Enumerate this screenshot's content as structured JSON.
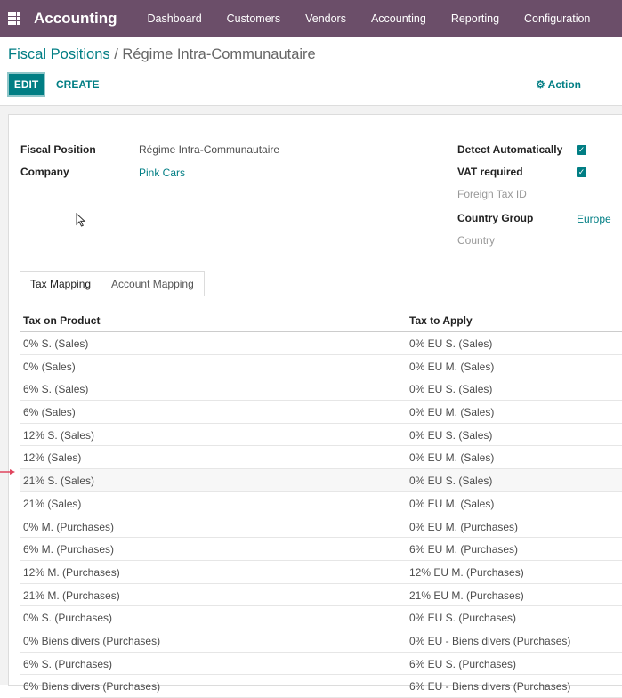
{
  "topbar": {
    "app_name": "Accounting",
    "menu": [
      "Dashboard",
      "Customers",
      "Vendors",
      "Accounting",
      "Reporting",
      "Configuration"
    ]
  },
  "breadcrumb": {
    "parent": "Fiscal Positions",
    "separator": " / ",
    "current": "Régime Intra-Communautaire"
  },
  "buttons": {
    "edit": "EDIT",
    "create": "CREATE",
    "action": "Action"
  },
  "form": {
    "fiscal_position_label": "Fiscal Position",
    "fiscal_position_value": "Régime Intra-Communautaire",
    "company_label": "Company",
    "company_value": "Pink Cars",
    "detect_auto_label": "Detect Automatically",
    "detect_auto_checked": true,
    "vat_required_label": "VAT required",
    "vat_required_checked": true,
    "foreign_tax_id_placeholder": "Foreign Tax ID",
    "country_group_label": "Country Group",
    "country_group_value": "Europe",
    "country_placeholder": "Country"
  },
  "tabs": [
    "Tax Mapping",
    "Account Mapping"
  ],
  "table": {
    "headers": [
      "Tax on Product",
      "Tax to Apply"
    ],
    "rows": [
      [
        "0% S. (Sales)",
        "0% EU S. (Sales)"
      ],
      [
        "0% (Sales)",
        "0% EU M. (Sales)"
      ],
      [
        "6% S. (Sales)",
        "0% EU S. (Sales)"
      ],
      [
        "6% (Sales)",
        "0% EU M. (Sales)"
      ],
      [
        "12% S. (Sales)",
        "0% EU S. (Sales)"
      ],
      [
        "12% (Sales)",
        "0% EU M. (Sales)"
      ],
      [
        "21% S. (Sales)",
        "0% EU S. (Sales)"
      ],
      [
        "21% (Sales)",
        "0% EU M. (Sales)"
      ],
      [
        "0% M. (Purchases)",
        "0% EU M. (Purchases)"
      ],
      [
        "6% M. (Purchases)",
        "6% EU M. (Purchases)"
      ],
      [
        "12% M. (Purchases)",
        "12% EU M. (Purchases)"
      ],
      [
        "21% M. (Purchases)",
        "21% EU M. (Purchases)"
      ],
      [
        "0% S. (Purchases)",
        "0% EU S. (Purchases)"
      ],
      [
        "0% Biens divers (Purchases)",
        "0% EU - Biens divers (Purchases)"
      ],
      [
        "6% S. (Purchases)",
        "6% EU S. (Purchases)"
      ],
      [
        "6% Biens divers (Purchases)",
        "6% EU - Biens divers (Purchases)"
      ]
    ]
  },
  "colors": {
    "brand": "#6b4e69",
    "accent": "#017e84",
    "annotation_arrow": "#e0455e"
  }
}
